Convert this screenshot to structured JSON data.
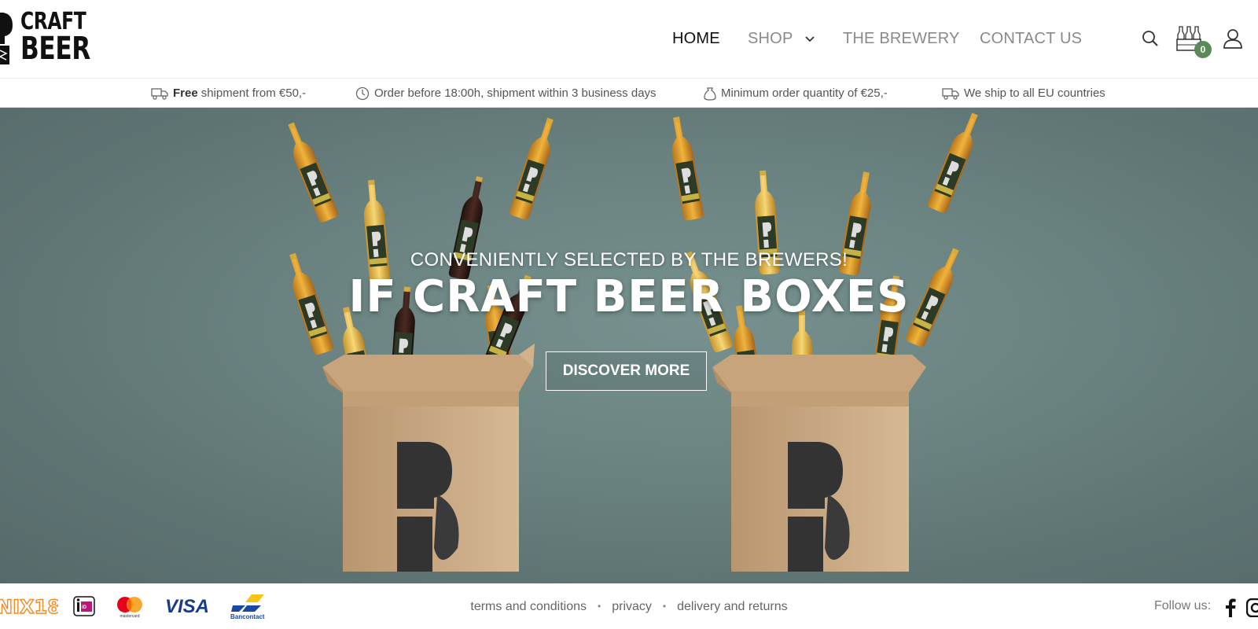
{
  "brand": {
    "line1": "CRAFT",
    "line2": "BEER"
  },
  "nav": {
    "home": "HOME",
    "shop": "SHOP",
    "brewery": "THE BREWERY",
    "contact": "CONTACT US"
  },
  "header_icons": {
    "search": "search-icon",
    "cart": "beer-crate-icon",
    "account": "user-icon",
    "cart_count": "0"
  },
  "usp": [
    {
      "icon": "truck-icon",
      "bold": "Free",
      "text": "shipment from €50,-"
    },
    {
      "icon": "clock-icon",
      "text": "Order before 18:00h, shipment within 3 business days"
    },
    {
      "icon": "bag-icon",
      "text": "Minimum order quantity of €25,-"
    },
    {
      "icon": "truck-icon",
      "text": "We ship to all EU countries"
    }
  ],
  "hero": {
    "subtitle": "CONVENIENTLY SELECTED BY THE BREWERS!",
    "title": "IF CRAFT BEER BOXES",
    "cta": "DISCOVER MORE"
  },
  "footer": {
    "payment_methods": [
      "NIX18",
      "iDEAL",
      "mastercard",
      "VISA",
      "Bancontact"
    ],
    "links": {
      "terms": "terms and conditions",
      "privacy": "privacy",
      "delivery": "delivery and returns"
    },
    "follow_label": "Follow us:",
    "social": [
      "facebook-icon",
      "instagram-icon"
    ]
  },
  "colors": {
    "hero_bg": "#6c8583",
    "nav_active": "#111111",
    "nav_inactive": "#8a8a8a",
    "badge": "#5a8a5a"
  }
}
